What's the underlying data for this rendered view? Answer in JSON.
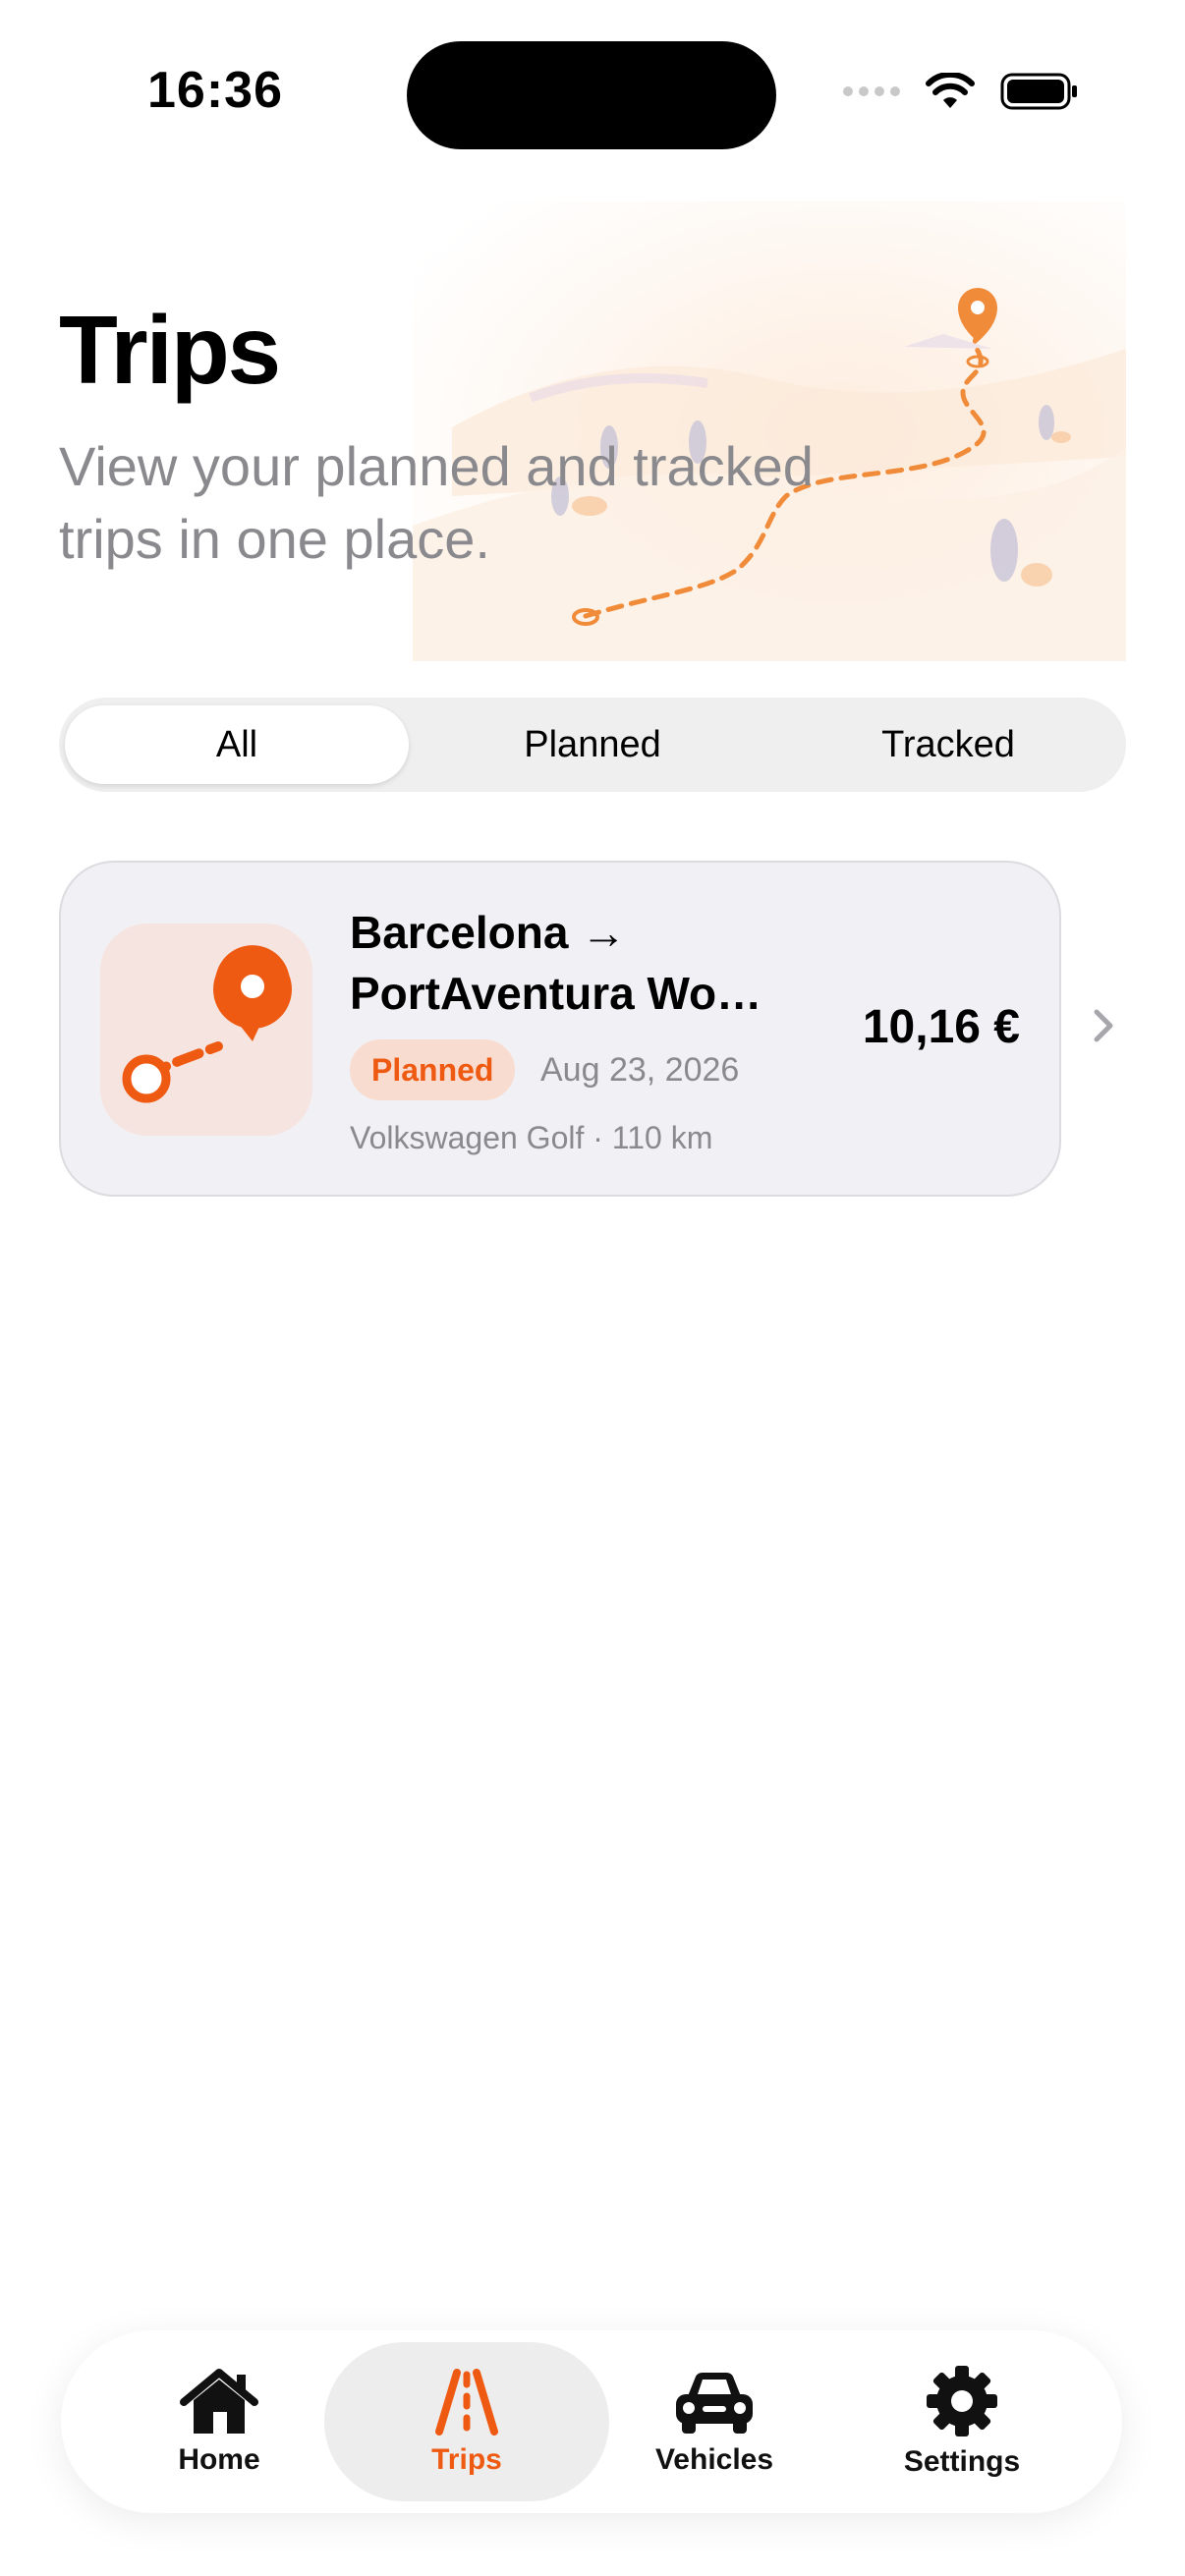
{
  "status": {
    "time": "16:36"
  },
  "header": {
    "title": "Trips",
    "subtitle": "View your planned and tracked trips in one place."
  },
  "filters": {
    "items": [
      "All",
      "Planned",
      "Tracked"
    ],
    "selected": "All"
  },
  "trips": [
    {
      "title_line1": "Barcelona →",
      "title_line2": "PortAventura World",
      "status": "Planned",
      "date": "Aug 23, 2026",
      "meta": "Volkswagen Golf · 110 km",
      "price": "10,16 €"
    }
  ],
  "tabbar": {
    "items": [
      {
        "label": "Home",
        "icon": "house-icon"
      },
      {
        "label": "Trips",
        "icon": "road-icon"
      },
      {
        "label": "Vehicles",
        "icon": "car-icon"
      },
      {
        "label": "Settings",
        "icon": "gear-icon"
      }
    ],
    "selected": "Trips"
  },
  "colors": {
    "accent": "#ef5a12",
    "card_bg": "#f1f0f5",
    "badge_bg": "#f9dcd0",
    "secondary_text": "#8a8a8e"
  }
}
